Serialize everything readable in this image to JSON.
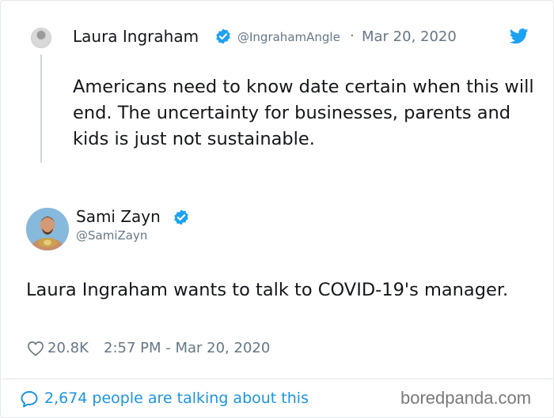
{
  "quoted_tweet": {
    "author_name": "Laura Ingraham",
    "handle": "@IngrahamAngle",
    "separator": "·",
    "date": "Mar 20, 2020",
    "text": "Americans need to know date certain when this will end.  The uncertainty for businesses, parents and kids is just not sustainable."
  },
  "tweet": {
    "author_name": "Sami Zayn",
    "handle": "@SamiZayn",
    "text": "Laura Ingraham wants to talk to COVID-19's manager.",
    "likes": "20.8K",
    "timestamp": "2:57 PM - Mar 20, 2020"
  },
  "footer": {
    "talking_label": "2,674 people are talking about this",
    "watermark": "boredpanda.com"
  },
  "colors": {
    "twitter_blue": "#1da1f2",
    "link_blue": "#1b95e0",
    "muted_gray": "#657786"
  },
  "icons": {
    "verified": "verified-badge-icon",
    "bird": "twitter-bird-icon",
    "heart": "heart-icon",
    "comment": "speech-bubble-icon"
  }
}
